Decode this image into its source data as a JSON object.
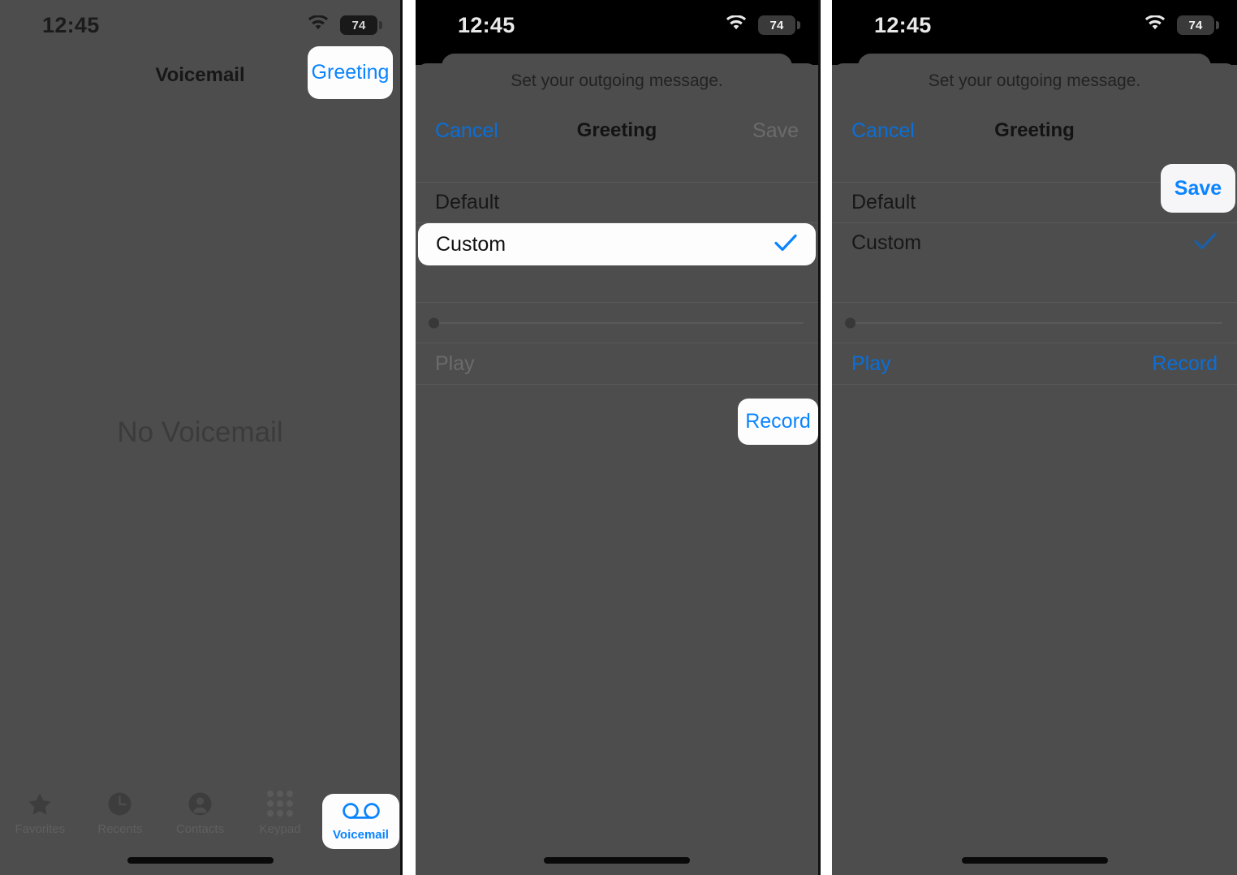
{
  "status_bar": {
    "time": "12:45",
    "wifi_icon": "wifi-icon",
    "battery_level": "74"
  },
  "colors": {
    "accent_blue": "#0a84ff",
    "accent_blue_dim": "#0a6fd8",
    "panel_gray": "#4d4d4d",
    "spotlight_white": "#fdfdfd",
    "disabled_gray": "#6b6b6b"
  },
  "panel1": {
    "nav_title": "Voicemail",
    "greeting_button": "Greeting",
    "empty_state": "No Voicemail",
    "tabs": [
      {
        "label": "Favorites",
        "icon": "star-icon",
        "active": false
      },
      {
        "label": "Recents",
        "icon": "clock-icon",
        "active": false
      },
      {
        "label": "Contacts",
        "icon": "person-icon",
        "active": false
      },
      {
        "label": "Keypad",
        "icon": "keypad-icon",
        "active": false
      },
      {
        "label": "Voicemail",
        "icon": "voicemail-icon",
        "active": true
      }
    ]
  },
  "panel2": {
    "sheet_subtitle": "Set your outgoing message.",
    "cancel_label": "Cancel",
    "sheet_title": "Greeting",
    "save_label": "Save",
    "save_enabled": false,
    "options": [
      {
        "label": "Default",
        "selected": false
      },
      {
        "label": "Custom",
        "selected": true
      }
    ],
    "scrubber_position_percent": 0,
    "play_label": "Play",
    "play_enabled": false,
    "record_label": "Record",
    "record_enabled": true,
    "highlight": "record-button"
  },
  "panel3": {
    "sheet_subtitle": "Set your outgoing message.",
    "cancel_label": "Cancel",
    "sheet_title": "Greeting",
    "save_label": "Save",
    "save_enabled": true,
    "options": [
      {
        "label": "Default",
        "selected": false
      },
      {
        "label": "Custom",
        "selected": true
      }
    ],
    "scrubber_position_percent": 0,
    "play_label": "Play",
    "play_enabled": true,
    "record_label": "Record",
    "record_enabled": true,
    "highlight": "save-button"
  }
}
